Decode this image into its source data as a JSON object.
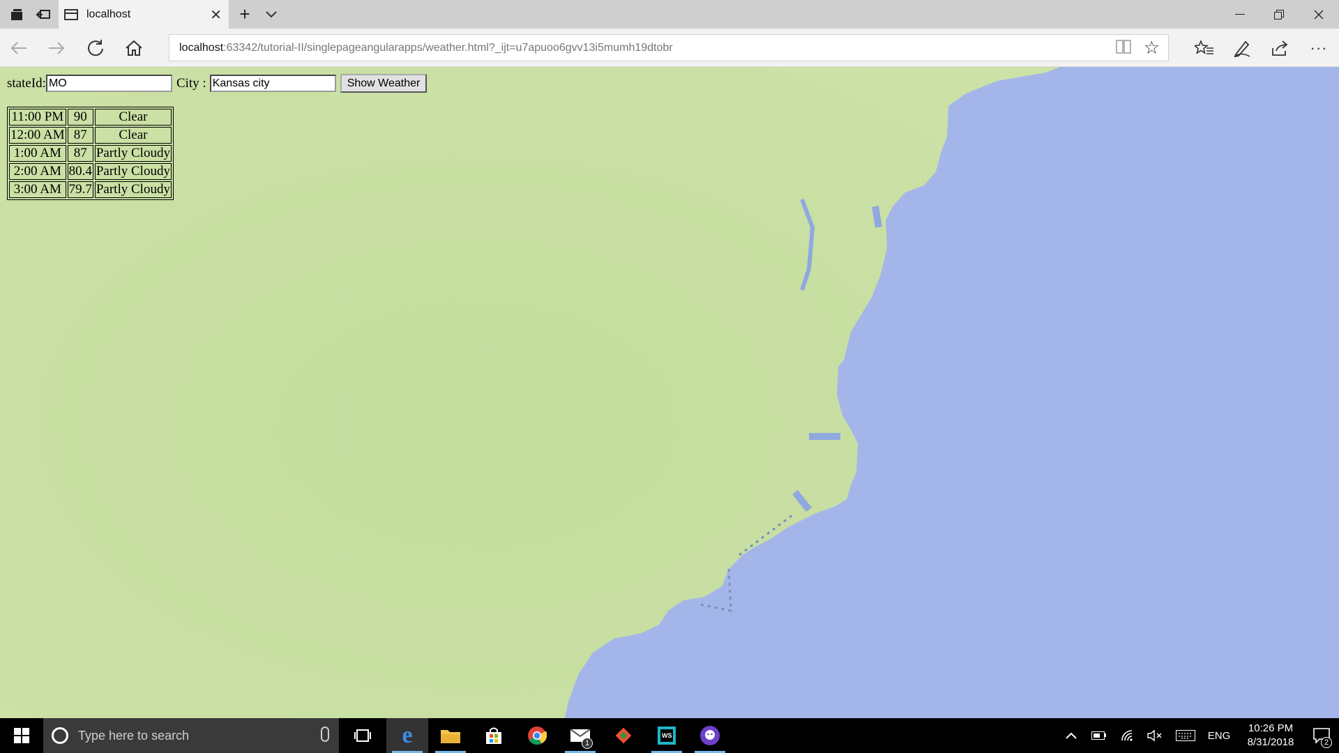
{
  "browser": {
    "tab_title": "localhost",
    "url_host": "localhost",
    "url_rest": ":63342/tutorial-II/singlepageangularapps/weather.html?_ijt=u7apuoo6gvv13i5mumh19dtobr"
  },
  "form": {
    "state_label": "stateId:",
    "state_value": "MO",
    "city_label": "City :",
    "city_value": "Kansas city",
    "show_button": "Show Weather"
  },
  "weather": [
    {
      "time": "11:00 PM",
      "temp": "90",
      "condition": "Clear"
    },
    {
      "time": "12:00 AM",
      "temp": "87",
      "condition": "Clear"
    },
    {
      "time": "1:00 AM",
      "temp": "87",
      "condition": "Partly Cloudy"
    },
    {
      "time": "2:00 AM",
      "temp": "80.4",
      "condition": "Partly Cloudy"
    },
    {
      "time": "3:00 AM",
      "temp": "79.7",
      "condition": "Partly Cloudy"
    }
  ],
  "taskbar": {
    "search_placeholder": "Type here to search",
    "language": "ENG",
    "time": "10:26 PM",
    "date": "8/31/2018",
    "notification_count": "2",
    "mail_badge": "1"
  },
  "colors": {
    "land": "#c8dea1",
    "water": "#a4b6e9",
    "taskbar": "#000000",
    "accent": "#76b9ed"
  }
}
